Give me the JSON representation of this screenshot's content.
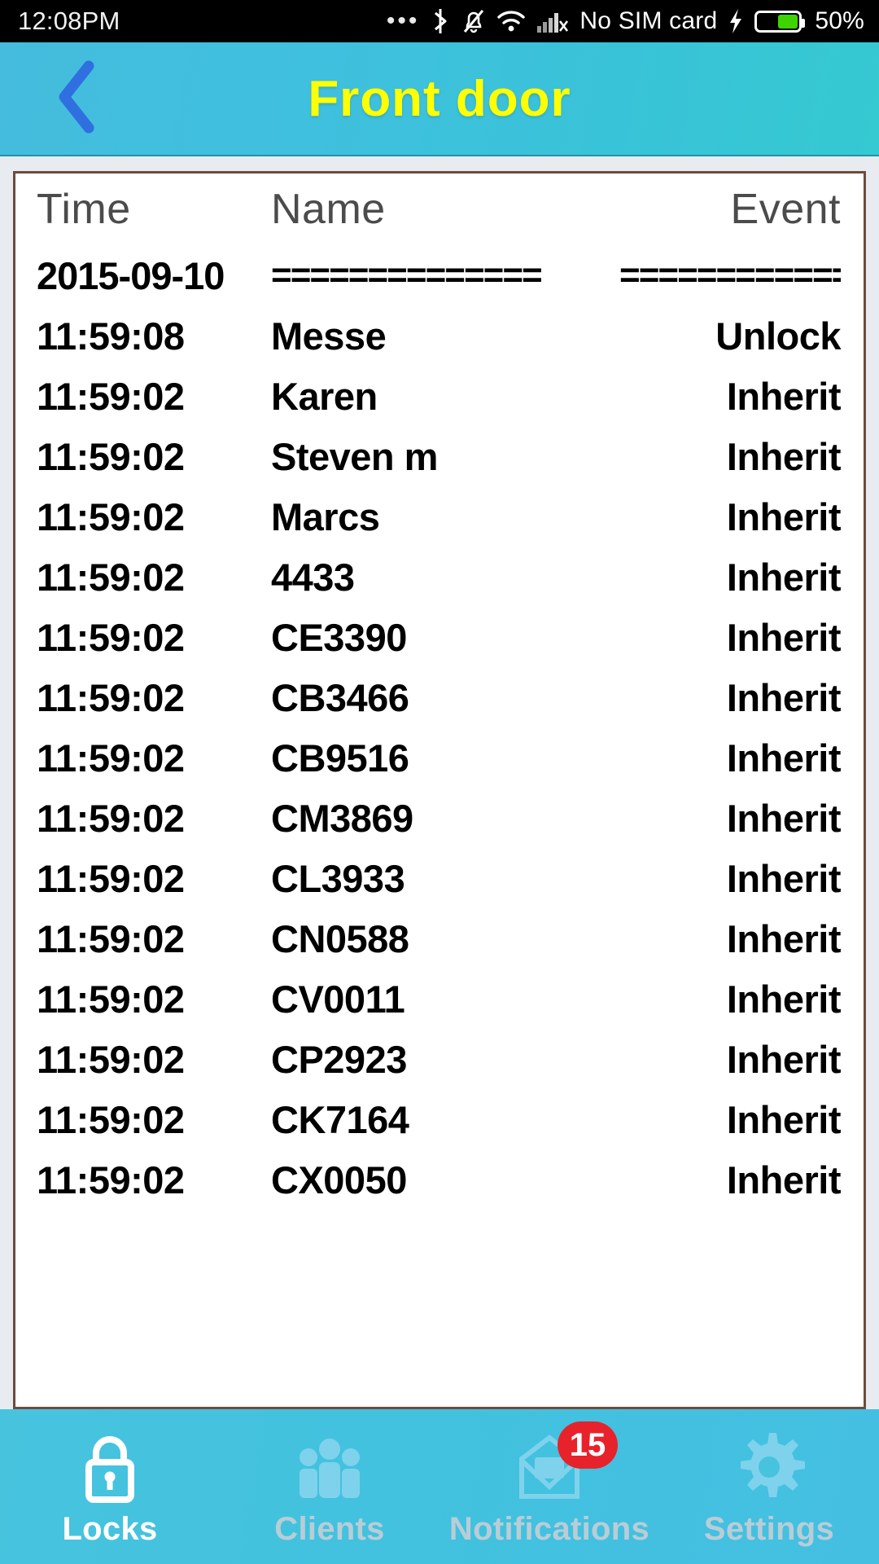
{
  "status_bar": {
    "time": "12:08PM",
    "dots": "•••",
    "bluetooth_icon": "bluetooth-icon",
    "silent_icon": "bell-muted-icon",
    "wifi_icon": "wifi-icon",
    "signal_icon": "signal-no-service-icon",
    "sim_text": "No SIM card",
    "charging_icon": "charging-bolt-icon",
    "battery_percent": "50%",
    "battery_level": 50
  },
  "header": {
    "back_icon": "chevron-left-icon",
    "title": "Front door",
    "title_color": "#ffff00",
    "background_color": "#3fc0de"
  },
  "table": {
    "columns": {
      "time": "Time",
      "name": "Name",
      "event": "Event"
    },
    "date_row": {
      "date": "2015-09-10",
      "name_separator": "==============",
      "event_separator": "=============="
    },
    "rows": [
      {
        "time": "11:59:08",
        "name": "Messe",
        "event": "Unlock"
      },
      {
        "time": "11:59:02",
        "name": "Karen",
        "event": "Inherit"
      },
      {
        "time": "11:59:02",
        "name": "Steven m",
        "event": "Inherit"
      },
      {
        "time": "11:59:02",
        "name": "Marcs",
        "event": "Inherit"
      },
      {
        "time": "11:59:02",
        "name": "4433",
        "event": "Inherit"
      },
      {
        "time": "11:59:02",
        "name": "CE3390",
        "event": "Inherit"
      },
      {
        "time": "11:59:02",
        "name": "CB3466",
        "event": "Inherit"
      },
      {
        "time": "11:59:02",
        "name": "CB9516",
        "event": "Inherit"
      },
      {
        "time": "11:59:02",
        "name": "CM3869",
        "event": "Inherit"
      },
      {
        "time": "11:59:02",
        "name": "CL3933",
        "event": "Inherit"
      },
      {
        "time": "11:59:02",
        "name": "CN0588",
        "event": "Inherit"
      },
      {
        "time": "11:59:02",
        "name": "CV0011",
        "event": "Inherit"
      },
      {
        "time": "11:59:02",
        "name": "CP2923",
        "event": "Inherit"
      },
      {
        "time": "11:59:02",
        "name": "CK7164",
        "event": "Inherit"
      },
      {
        "time": "11:59:02",
        "name": "CX0050",
        "event": "Inherit"
      }
    ]
  },
  "bottom_nav": {
    "items": [
      {
        "label": "Locks",
        "icon": "lock-icon",
        "active": true
      },
      {
        "label": "Clients",
        "icon": "people-icon",
        "active": false
      },
      {
        "label": "Notifications",
        "icon": "envelope-icon",
        "active": false,
        "badge": "15"
      },
      {
        "label": "Settings",
        "icon": "gear-icon",
        "active": false
      }
    ],
    "badge_color": "#e8222a"
  }
}
